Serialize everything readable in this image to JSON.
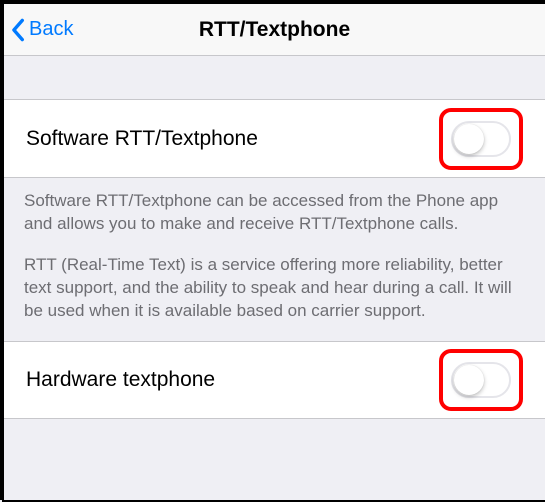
{
  "nav": {
    "back_label": "Back",
    "title": "RTT/Textphone"
  },
  "rows": {
    "software": {
      "label": "Software RTT/Textphone",
      "enabled": false
    },
    "hardware": {
      "label": "Hardware textphone",
      "enabled": false
    }
  },
  "description": {
    "p1": "Software RTT/Textphone can be accessed from the Phone app and allows you to make and receive RTT/Textphone calls.",
    "p2": "RTT (Real-Time Text) is a service offering more reliability, better text support, and the ability to speak and hear during a call. It will be used when it is available based on carrier support."
  },
  "highlight_color": "#ff0000"
}
